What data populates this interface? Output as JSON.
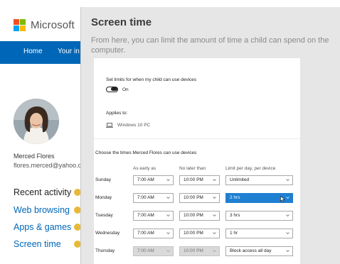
{
  "brand": {
    "name": "Microsoft"
  },
  "nav": {
    "home": "Home",
    "your": "Your in"
  },
  "profile": {
    "name": "Merced Flores",
    "email": "flores.merced@yahoo.com"
  },
  "sidebar": {
    "links": [
      {
        "label": "Recent activity"
      },
      {
        "label": "Web browsing"
      },
      {
        "label": "Apps & games"
      },
      {
        "label": "Screen time"
      }
    ]
  },
  "overlay": {
    "title": "Screen time",
    "description": "From here, you can limit the amount of time a child can spend on the computer."
  },
  "limits": {
    "heading": "Set limits for when my child can use devices",
    "toggle_state": "On"
  },
  "applies": {
    "label": "Applies to:",
    "device": "Windows 10 PC",
    "device_icon": "laptop-icon"
  },
  "schedule": {
    "heading": "Choose the times Merced Flores can use devices",
    "columns": {
      "early": "As early as",
      "later": "No later than",
      "limit": "Limit per day, per device"
    },
    "rows": [
      {
        "day": "Sunday",
        "early": "7:00 AM",
        "later": "10:00 PM",
        "limit": "Unlimited"
      },
      {
        "day": "Monday",
        "early": "7:00 AM",
        "later": "10:00 PM",
        "limit": "2 hrs"
      },
      {
        "day": "Tuesday",
        "early": "7:00 AM",
        "later": "10:00 PM",
        "limit": "3 hrs"
      },
      {
        "day": "Wednesday",
        "early": "7:00 AM",
        "later": "10:00 PM",
        "limit": "1 hr"
      },
      {
        "day": "Thursday",
        "early": "7:00 AM",
        "later": "10:00 PM",
        "limit": "Block access all day"
      }
    ]
  },
  "colors": {
    "accent": "#0067b8",
    "active_select": "#1f7fd1",
    "badge": "#e8b939"
  }
}
